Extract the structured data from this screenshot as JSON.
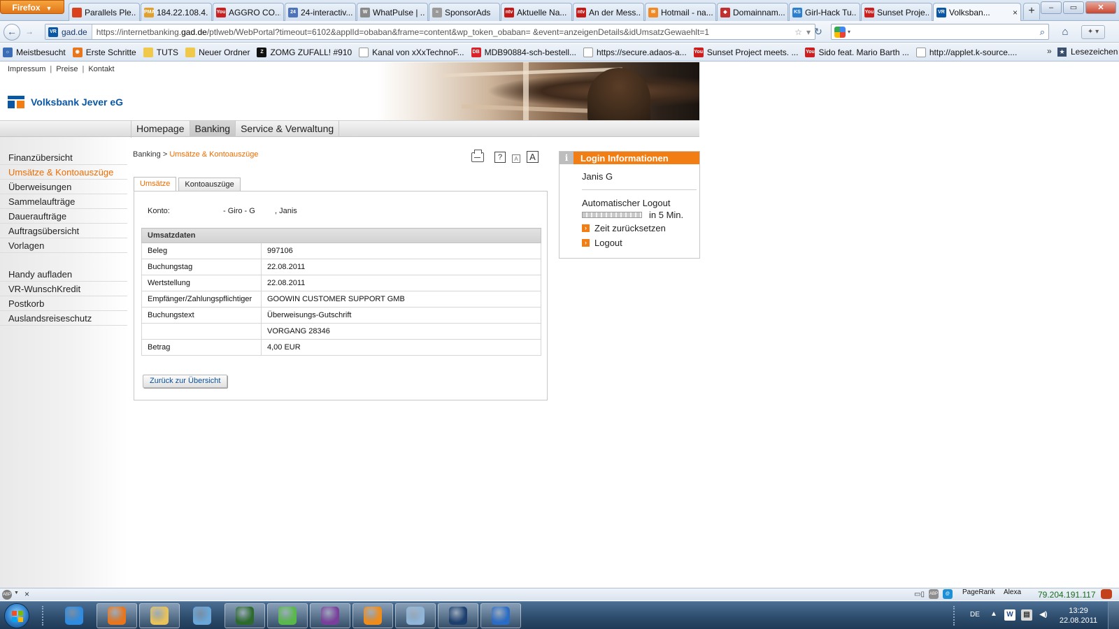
{
  "browser": {
    "menu_button": "Firefox",
    "tabs": [
      {
        "label": "Parallels Ple...",
        "icon": "parallels-icon",
        "color": "#d9411e",
        "glyph": ""
      },
      {
        "label": "184.22.108.4...",
        "icon": "pma-icon",
        "color": "#e0a030",
        "glyph": "PMA"
      },
      {
        "label": "AGGRO CO...",
        "icon": "youtube-icon",
        "color": "#cc2020",
        "glyph": "You"
      },
      {
        "label": "24-interactiv...",
        "icon": "page-icon",
        "color": "#4d74b8",
        "glyph": "24"
      },
      {
        "label": "WhatPulse | ...",
        "icon": "whatpulse-icon",
        "color": "#8a8a8a",
        "glyph": "W"
      },
      {
        "label": "SponsorAds",
        "icon": "sponsorads-icon",
        "color": "#9a9a9a",
        "glyph": "≈"
      },
      {
        "label": "Aktuelle Na...",
        "icon": "news-icon",
        "color": "#c41a1a",
        "glyph": "ntv"
      },
      {
        "label": "An der Mess...",
        "icon": "news-icon",
        "color": "#c41a1a",
        "glyph": "ntv"
      },
      {
        "label": "Hotmail - na...",
        "icon": "hotmail-icon",
        "color": "#f08a24",
        "glyph": "✉"
      },
      {
        "label": "Domainnam...",
        "icon": "domain-icon",
        "color": "#c03030",
        "glyph": "◆"
      },
      {
        "label": "Girl-Hack Tu...",
        "icon": "ks-icon",
        "color": "#2c7fd0",
        "glyph": "KS"
      },
      {
        "label": "Sunset Proje...",
        "icon": "youtube-icon",
        "color": "#cc2020",
        "glyph": "You"
      },
      {
        "label": "Volksban...",
        "icon": "volksbank-icon",
        "color": "#0a57a5",
        "glyph": "VR",
        "active": true
      }
    ],
    "tab_close": "×",
    "new_tab": "+",
    "window_controls": {
      "minimize": "–",
      "maximize": "▭",
      "close": "✕"
    },
    "back": "←",
    "forward": "→",
    "site_identity": "gad.de",
    "url_prefix": "https://internetbanking.",
    "url_domain": "gad.de",
    "url_rest": "/ptlweb/WebPortal?timeout=6102&applId=obaban&frame=content&wp_token_obaban=                    &event=anzeigenDetails&idUmsatzGewaehlt=1",
    "bookmark_star": "☆",
    "dropdown": "▾",
    "reload": "↻",
    "search_icon": "⌕",
    "home": "⌂",
    "addon": "✦ ▾",
    "bookmarks": [
      {
        "label": "Meistbesucht",
        "icon": "most-visited-icon",
        "color": "#3a6db5",
        "glyph": "☼"
      },
      {
        "label": "Erste Schritte",
        "icon": "firefox-icon",
        "color": "#e8761c",
        "glyph": "◉"
      },
      {
        "label": "TUTS",
        "icon": "folder-icon",
        "color": "#f0c84a",
        "glyph": ""
      },
      {
        "label": "Neuer Ordner",
        "icon": "folder-icon",
        "color": "#f0c84a",
        "glyph": ""
      },
      {
        "label": "ZOMG ZUFALL! #910",
        "icon": "zomg-icon",
        "color": "#111111",
        "glyph": "Z"
      },
      {
        "label": "Kanal von xXxTechnoF...",
        "icon": "page-icon",
        "color": "#ffffff",
        "glyph": ""
      },
      {
        "label": "MDB90884-sch-bestell...",
        "icon": "db-icon",
        "color": "#d8232a",
        "glyph": "DB"
      },
      {
        "label": "https://secure.adaos-a...",
        "icon": "page-icon",
        "color": "#ffffff",
        "glyph": ""
      },
      {
        "label": "Sunset Project meets. ...",
        "icon": "youtube-icon",
        "color": "#cc2020",
        "glyph": "You"
      },
      {
        "label": "Sido feat. Mario Barth ...",
        "icon": "youtube-icon",
        "color": "#cc2020",
        "glyph": "You"
      },
      {
        "label": "http://applet.k-source....",
        "icon": "page-icon",
        "color": "#ffffff",
        "glyph": ""
      }
    ],
    "bookmarks_more": "»",
    "bookmarks_menu": "Lesezeichen"
  },
  "bank": {
    "meta_links": [
      "Impressum",
      "Preise",
      "Kontakt"
    ],
    "meta_sep": "|",
    "brand": "Volksbank Jever eG",
    "topnav": [
      {
        "label": "Homepage"
      },
      {
        "label": "Banking",
        "active": true
      },
      {
        "label": "Service & Verwaltung"
      }
    ],
    "sidebar": [
      {
        "label": "Finanzübersicht"
      },
      {
        "label": "Umsätze & Kontoauszüge",
        "active": true
      },
      {
        "label": "Überweisungen"
      },
      {
        "label": "Sammelaufträge"
      },
      {
        "label": "Daueraufträge"
      },
      {
        "label": "Auftragsübersicht"
      },
      {
        "label": "Vorlagen"
      }
    ],
    "sidebar2": [
      {
        "label": "Handy aufladen"
      },
      {
        "label": "VR-WunschKredit"
      },
      {
        "label": "Postkorb"
      },
      {
        "label": "Auslandsreiseschutz"
      }
    ],
    "breadcrumb": {
      "root": "Banking",
      "sep": " > ",
      "current": "Umsätze & Kontoauszüge"
    },
    "tools": {
      "help": "?",
      "font_small": "A",
      "font_large": "A"
    },
    "tabs": [
      {
        "label": "Umsätze",
        "active": true
      },
      {
        "label": "Kontoauszüge"
      }
    ],
    "konto": {
      "label": "Konto:",
      "account": "- Giro - G",
      "holder": ", Janis"
    },
    "table_header": "Umsatzdaten",
    "rows": [
      {
        "label": "Beleg",
        "value": "997106"
      },
      {
        "label": "Buchungstag",
        "value": "22.08.2011"
      },
      {
        "label": "Wertstellung",
        "value": "22.08.2011"
      },
      {
        "label": "Empfänger/Zahlungspflichtiger",
        "value": "GOOWIN CUSTOMER SUPPORT GMB"
      },
      {
        "label": "Buchungstext",
        "value": "Überweisungs-Gutschrift"
      },
      {
        "label": "",
        "value": "VORGANG 28346"
      },
      {
        "label": "Betrag",
        "value": "4,00 EUR"
      }
    ],
    "back_button": "Zurück zur Übersicht",
    "login": {
      "icon": "i",
      "title": "Login Informationen",
      "user": "Janis G",
      "auto_logout": "Automatischer Logout",
      "logout_progress": 0,
      "in_time": "in 5 Min.",
      "reset_link": "Zeit zurücksetzen",
      "logout_link": "Logout",
      "arrow": "›"
    }
  },
  "statusbar": {
    "abp": "ABP",
    "close": "×",
    "pagerank": "PageRank",
    "alexa": "Alexa",
    "ip": "79.204.191.117"
  },
  "taskbar": {
    "apps": [
      {
        "name": "internet-explorer-icon",
        "color": "#2e8be0"
      },
      {
        "name": "firefox-icon",
        "color": "#e8761c",
        "open": true
      },
      {
        "name": "explorer-icon",
        "color": "#e8c25a",
        "open": true
      },
      {
        "name": "notes-icon",
        "color": "#6aa6d8"
      },
      {
        "name": "security-icon",
        "color": "#2d6a2d",
        "open": true
      },
      {
        "name": "messenger-icon",
        "color": "#58b84a",
        "open": true
      },
      {
        "name": "winrar-icon",
        "color": "#7a3f9a",
        "open": true
      },
      {
        "name": "media-player-icon",
        "color": "#f08c1a",
        "open": true
      },
      {
        "name": "paint-icon",
        "color": "#8fb5d8",
        "open": true
      },
      {
        "name": "keepass-icon",
        "color": "#1d3f6e",
        "open": true
      },
      {
        "name": "word-doc-icon",
        "color": "#2a6bc4",
        "open": true
      }
    ],
    "lang": "DE",
    "tray_up": "▲",
    "time": "13:29",
    "date": "22.08.2011"
  }
}
